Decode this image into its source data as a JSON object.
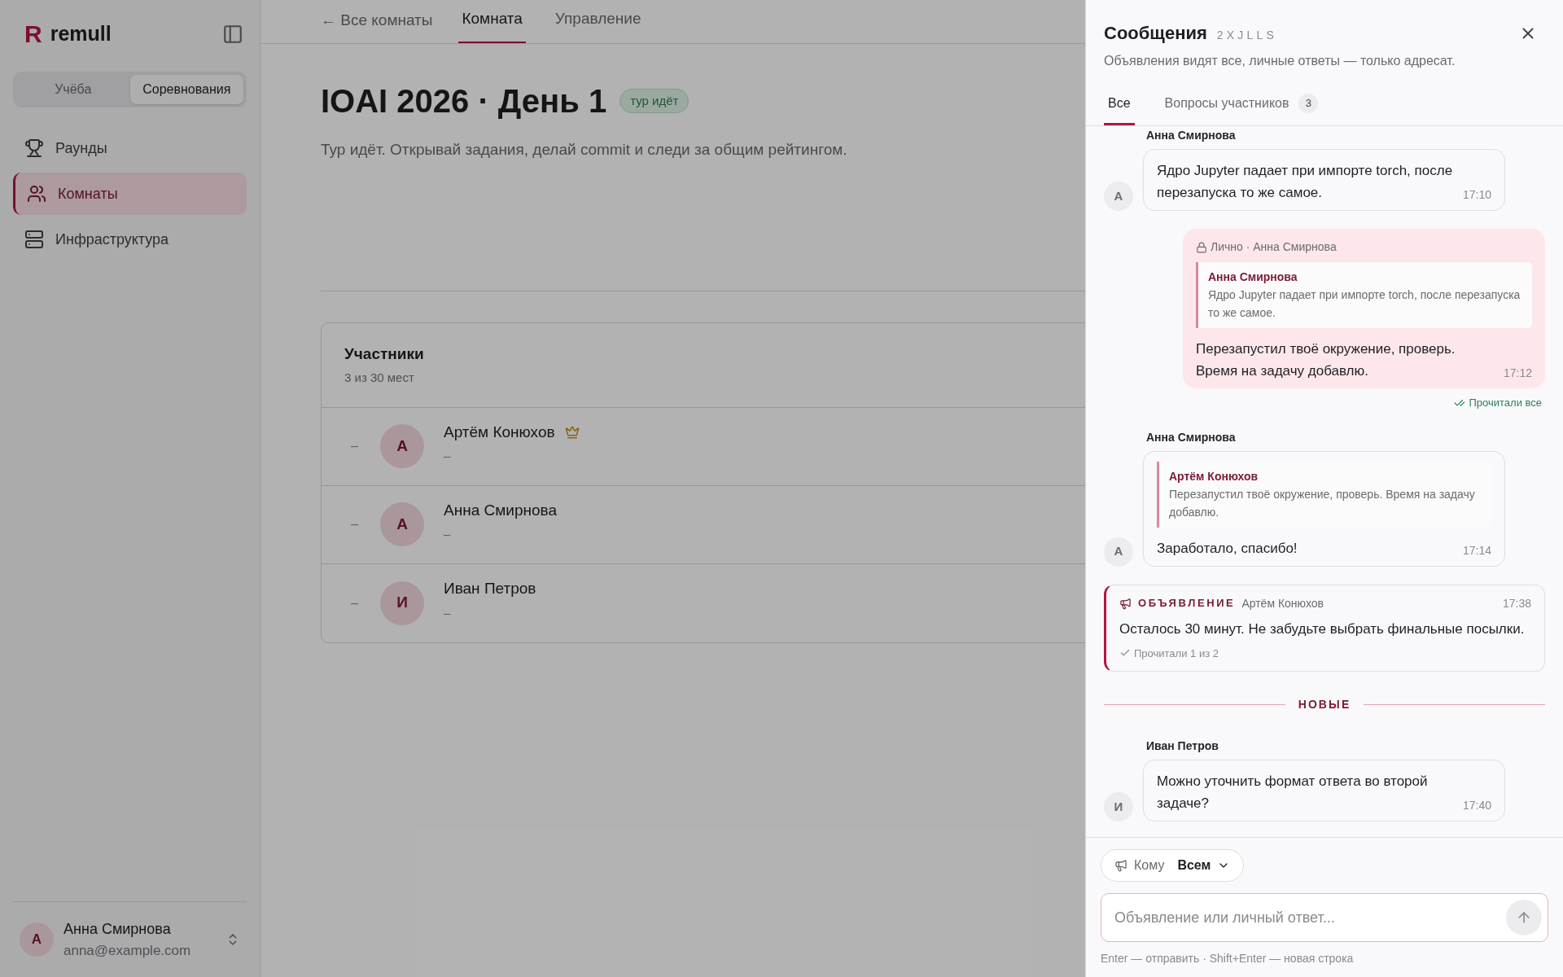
{
  "sidebar": {
    "logo_mark": "R",
    "brand": "remull",
    "segments": [
      {
        "label": "Учёба",
        "selected": false
      },
      {
        "label": "Соревнования",
        "selected": true
      }
    ],
    "nav": [
      {
        "label": "Раунды",
        "selected": false
      },
      {
        "label": "Комнаты",
        "selected": true
      },
      {
        "label": "Инфраструктура",
        "selected": false
      }
    ],
    "user": {
      "initial": "А",
      "name": "Анна Смирнова",
      "email": "anna@example.com"
    }
  },
  "main": {
    "back_link": "← Все комнаты",
    "tabs": [
      {
        "label": "Комната",
        "selected": true
      },
      {
        "label": "Управление",
        "selected": false
      }
    ],
    "title": "IOAI 2026 · День 1",
    "status": "тур идёт",
    "description": "Тур идёт. Открывай задания, делай commit и следи за общим рейтингом.",
    "participants": {
      "title": "Участники",
      "subtitle": "3 из 30 мест",
      "rows": [
        {
          "rank": "–",
          "initial": "А",
          "name": "Артём Конюхов",
          "owner": true,
          "detail": "–"
        },
        {
          "rank": "–",
          "initial": "А",
          "name": "Анна Смирнова",
          "owner": false,
          "detail": "–"
        },
        {
          "rank": "–",
          "initial": "И",
          "name": "Иван Петров",
          "owner": false,
          "detail": "–"
        }
      ]
    }
  },
  "panel": {
    "title": "Сообщения",
    "code": "2XJLLS",
    "subtitle": "Объявления видят все, личные ответы — только адресат.",
    "tabs": [
      {
        "label": "Все",
        "selected": true
      },
      {
        "label": "Вопросы участников",
        "count": "3",
        "selected": false
      }
    ],
    "messages": [
      {
        "kind": "incoming",
        "author": "Анна Смирнова",
        "initial": "А",
        "text": "Ядро Jupyter падает при импорте torch, после перезапуска то же самое.",
        "time": "17:10"
      },
      {
        "kind": "outgoing",
        "visibility": "Лично · Анна Смирнова",
        "quote": {
          "author": "Анна Смирнова",
          "text": "Ядро Jupyter падает при импорте torch, после перезапуска то же самое."
        },
        "text": "Перезапустил твоё окружение, проверь. Время на задачу добавлю.",
        "time": "17:12",
        "receipt": {
          "text": "Прочитали все",
          "all_read": true
        }
      },
      {
        "kind": "incoming",
        "author": "Анна Смирнова",
        "initial": "А",
        "quote": {
          "author": "Артём Конюхов",
          "text": "Перезапустил твоё окружение, проверь. Время на задачу добавлю."
        },
        "text": "Заработало, спасибо!",
        "time": "17:14"
      },
      {
        "kind": "announcement",
        "label": "ОБЪЯВЛЕНИЕ",
        "author": "Артём Конюхов",
        "time": "17:38",
        "text": "Осталось 30 минут. Не забудьте выбрать финальные посылки.",
        "receipt": {
          "text": "Прочитали 1 из 2",
          "all_read": false
        }
      },
      {
        "kind": "divider",
        "label": "НОВЫЕ"
      },
      {
        "kind": "incoming",
        "author": "Иван Петров",
        "initial": "И",
        "text": "Можно уточнить формат ответа во второй задаче?",
        "time": "17:40"
      }
    ],
    "composer": {
      "to_label": "Кому",
      "to_value": "Всем",
      "placeholder": "Объявление или личный ответ...",
      "hint": "Enter — отправить · Shift+Enter — новая строка"
    }
  }
}
